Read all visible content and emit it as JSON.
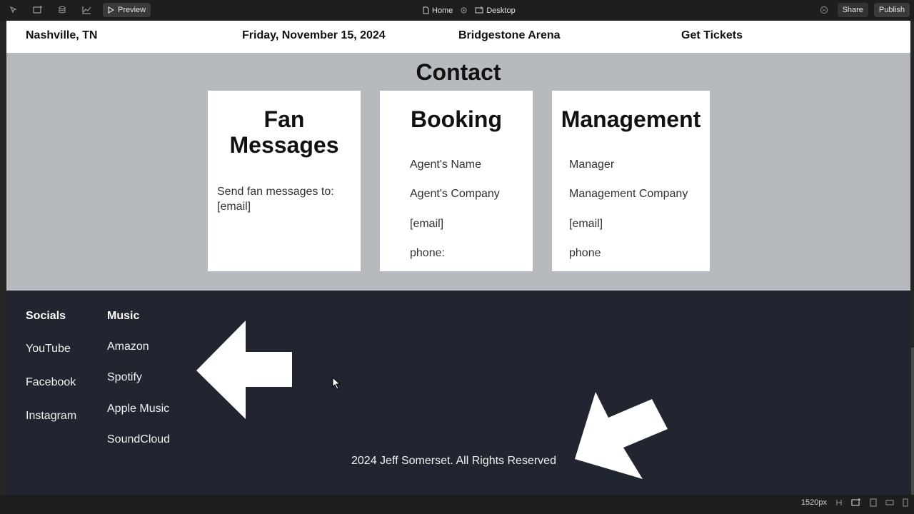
{
  "editor": {
    "preview_label": "Preview",
    "page_label": "Home",
    "device_label": "Desktop",
    "share_label": "Share",
    "publish_label": "Publish",
    "width_label": "1520px"
  },
  "topnav": {
    "location": "Nashville, TN",
    "date": "Friday, November 15, 2024",
    "venue": "Bridgestone Arena",
    "tickets": "Get Tickets"
  },
  "contact": {
    "title": "Contact",
    "fan": {
      "title": "Fan Messages",
      "text": "Send fan messages to: [email]"
    },
    "booking": {
      "title": "Booking",
      "name": "Agent's Name",
      "company": "Agent's Company",
      "email": "[email]",
      "phone": "phone:"
    },
    "management": {
      "title": "Management",
      "name": "Manager",
      "company": "Management Company",
      "email": "[email]",
      "phone": "phone"
    }
  },
  "footer": {
    "socials_heading": "Socials",
    "socials": [
      "YouTube",
      "Facebook",
      "Instagram"
    ],
    "music_heading": "Music",
    "music": [
      "Amazon",
      "Spotify",
      "Apple Music",
      "SoundCloud"
    ],
    "copyright": "2024 Jeff Somerset. All Rights Reserved"
  },
  "icons": [
    "cursor-icon",
    "insert-icon",
    "database-icon",
    "analytics-icon",
    "play-icon",
    "page-icon",
    "gear-icon",
    "desktop-icon",
    "comment-icon",
    "arrow-left-icon",
    "arrow-down-left-icon",
    "mouse-pointer-icon"
  ]
}
